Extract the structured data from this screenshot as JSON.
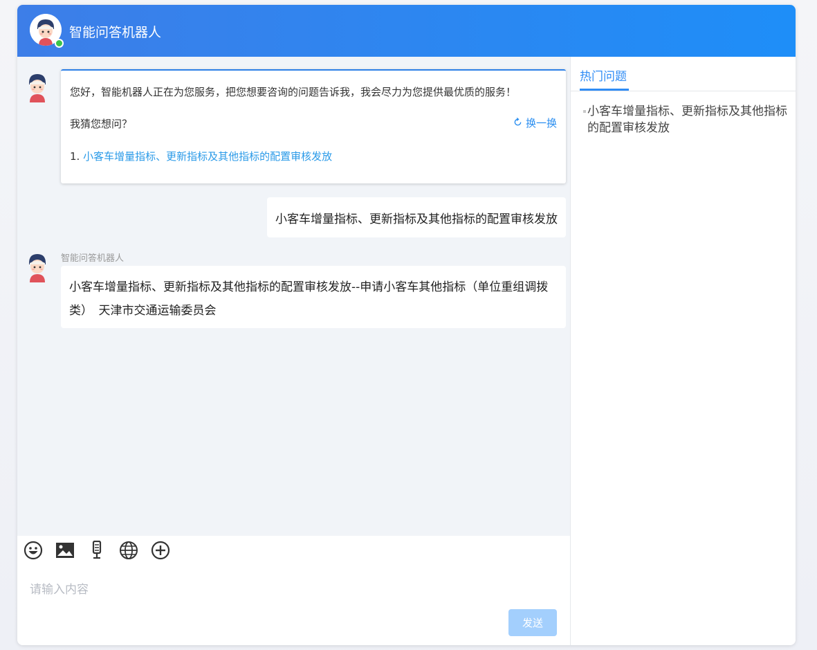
{
  "header": {
    "title": "智能问答机器人"
  },
  "welcome": {
    "greeting": "您好，智能机器人正在为您服务，把您想要咨询的问题告诉我，我会尽力为您提供最优质的服务！",
    "guess_label": "我猜您想问？",
    "refresh_label": "换一换",
    "suggestions": [
      {
        "number": "1.",
        "text": "小客车增量指标、更新指标及其他指标的配置审核发放"
      }
    ]
  },
  "messages": {
    "user_message": "小客车增量指标、更新指标及其他指标的配置审核发放",
    "bot_name": "智能问答机器人",
    "bot_answer": "小客车增量指标、更新指标及其他指标的配置审核发放--申请小客车其他指标（单位重组调拨类）　天津市交通运输委员会"
  },
  "right_panel": {
    "tab_label": "热门问题",
    "hot_questions": [
      "小客车增量指标、更新指标及其他指标的配置审核发放"
    ]
  },
  "input": {
    "placeholder": "请输入内容",
    "send_label": "发送",
    "tools": [
      "emoji-icon",
      "image-icon",
      "microphone-icon",
      "globe-icon",
      "plus-circle-icon"
    ]
  },
  "colors": {
    "header_start": "#3d7ee8",
    "header_end": "#1e8ef8",
    "accent": "#2f8cf5",
    "link": "#2a9ae8",
    "online": "#3bc44a",
    "send_disabled": "#a3cffd",
    "chat_bg": "#f1f4f8"
  }
}
